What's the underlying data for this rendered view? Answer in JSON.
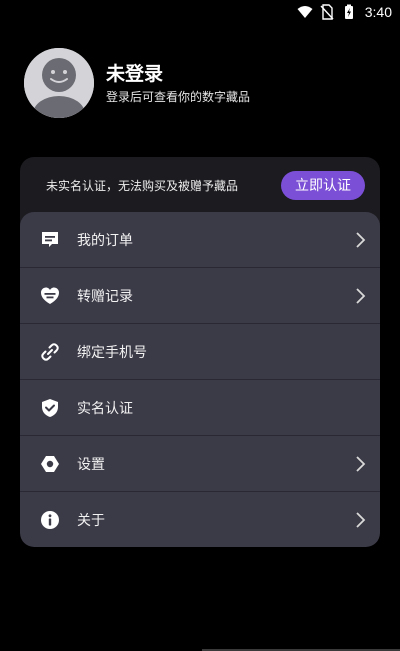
{
  "status_bar": {
    "time": "3:40"
  },
  "profile": {
    "name": "未登录",
    "subtitle": "登录后可查看你的数字藏品"
  },
  "verify": {
    "text": "未实名认证，无法购买及被赠予藏品",
    "button_label": "立即认证",
    "accent": "#7b4fd6"
  },
  "menu": {
    "items": [
      {
        "label": "我的订单",
        "icon": "order-icon",
        "chevron": true
      },
      {
        "label": "转赠记录",
        "icon": "gift-transfer-icon",
        "chevron": true
      },
      {
        "label": "绑定手机号",
        "icon": "link-icon",
        "chevron": false
      },
      {
        "label": "实名认证",
        "icon": "shield-check-icon",
        "chevron": false
      },
      {
        "label": "设置",
        "icon": "settings-icon",
        "chevron": true
      },
      {
        "label": "关于",
        "icon": "info-icon",
        "chevron": true
      }
    ]
  }
}
